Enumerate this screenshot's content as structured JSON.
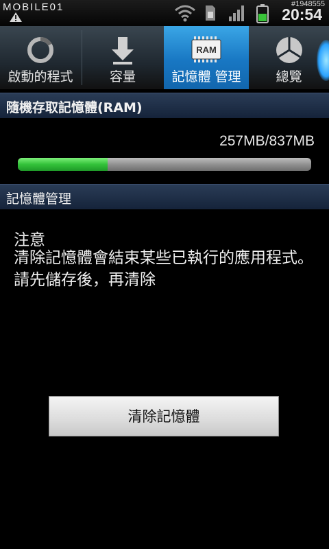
{
  "status_bar": {
    "watermark": "MOBILE01",
    "watermark_id": "#1948555",
    "time": "20:54",
    "icons": [
      "warning-icon",
      "wifi-icon",
      "sim-card-icon",
      "signal-icon",
      "battery-icon"
    ],
    "battery_color": "#39c439"
  },
  "tabs": [
    {
      "label": "啟動的程式",
      "icon": "running-apps-icon",
      "active": false
    },
    {
      "label": "容量",
      "icon": "download-arrow-icon",
      "active": false
    },
    {
      "label": "記憶體 管理",
      "icon": "ram-chip-icon",
      "icon_text": "RAM",
      "active": true
    },
    {
      "label": "總覽",
      "icon": "pie-chart-icon",
      "active": false
    }
  ],
  "ram_section": {
    "header": "隨機存取記憶體(RAM)",
    "usage_text": "257MB/837MB",
    "used_mb": 257,
    "total_mb": 837,
    "fill_color": "#33c23a"
  },
  "memory_section": {
    "header": "記憶體管理",
    "notice_title": "注意",
    "notice_body": "清除記憶體會結束某些已執行的應用程式。請先儲存後，再清除"
  },
  "clear_button_label": "清除記憶體",
  "colors": {
    "active_tab": "#1877c3",
    "header_bg": "#1e2f48"
  }
}
